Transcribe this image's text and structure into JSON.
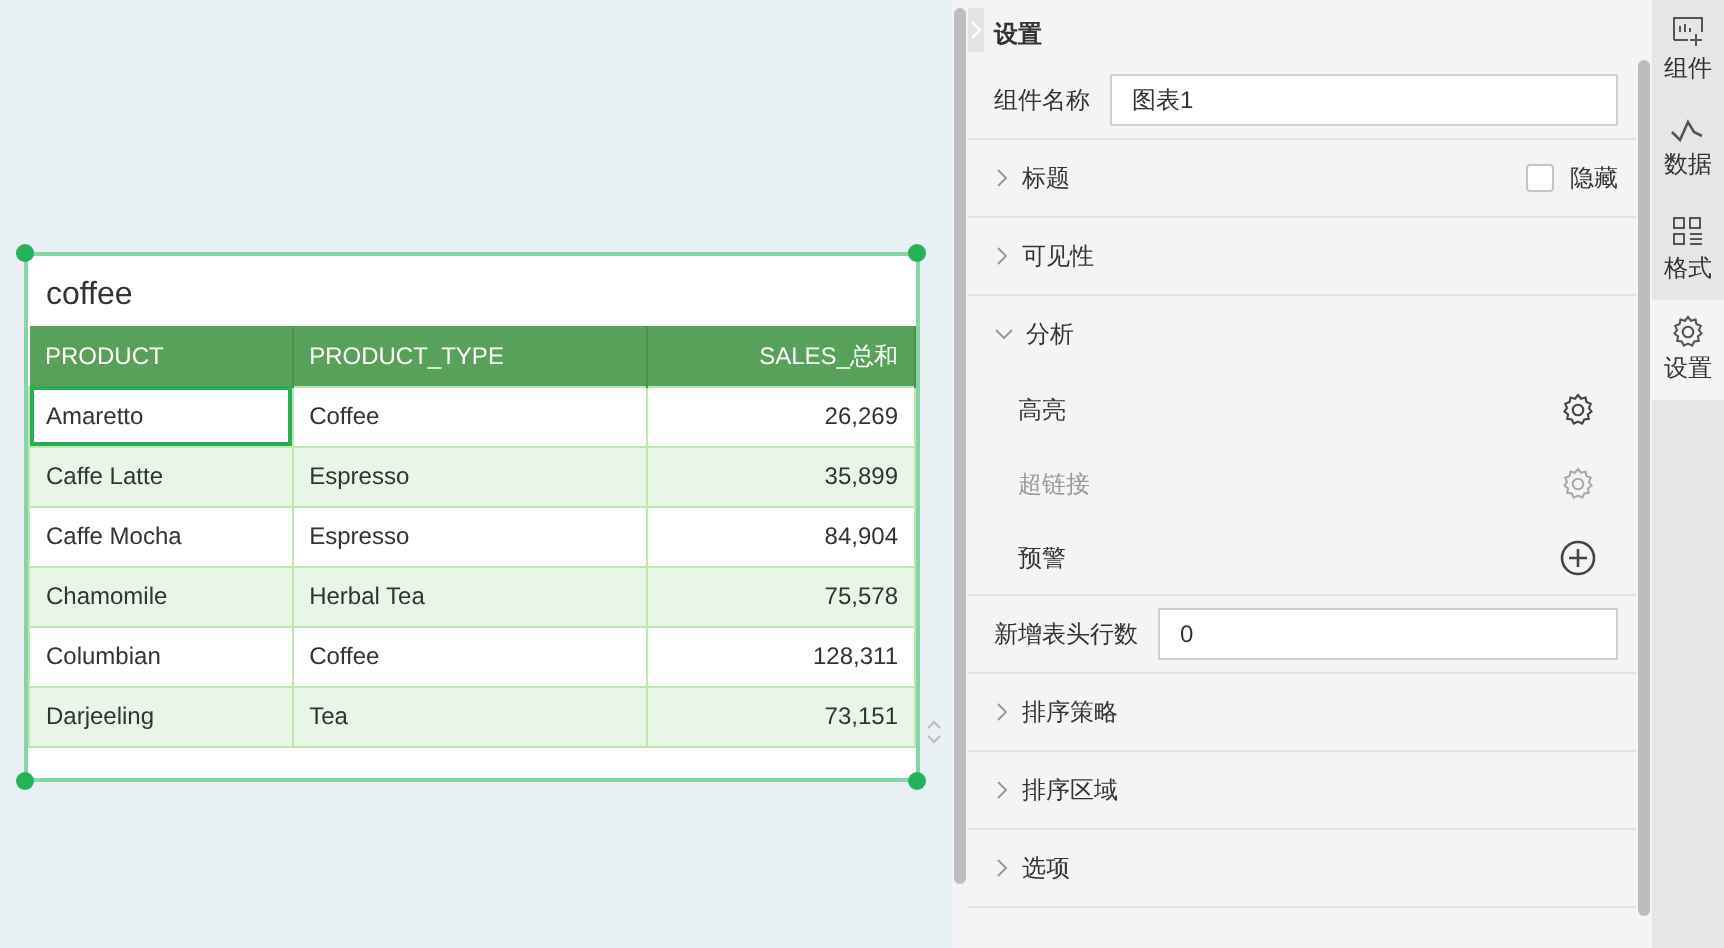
{
  "widget": {
    "title": "coffee",
    "columns": [
      {
        "label": "PRODUCT"
      },
      {
        "label": "PRODUCT_TYPE"
      },
      {
        "label": "SALES_总和"
      }
    ],
    "rows": [
      {
        "cells": [
          {
            "text": "Amaretto",
            "selected": true
          },
          {
            "text": "Coffee",
            "selected": false
          },
          {
            "text": "26,269",
            "selected": false
          }
        ]
      },
      {
        "cells": [
          {
            "text": "Caffe Latte",
            "selected": false
          },
          {
            "text": "Espresso",
            "selected": false
          },
          {
            "text": "35,899",
            "selected": false
          }
        ]
      },
      {
        "cells": [
          {
            "text": "Caffe Mocha",
            "selected": false
          },
          {
            "text": "Espresso",
            "selected": false
          },
          {
            "text": "84,904",
            "selected": false
          }
        ]
      },
      {
        "cells": [
          {
            "text": "Chamomile",
            "selected": false
          },
          {
            "text": "Herbal Tea",
            "selected": false
          },
          {
            "text": "75,578",
            "selected": false
          }
        ]
      },
      {
        "cells": [
          {
            "text": "Columbian",
            "selected": false
          },
          {
            "text": "Coffee",
            "selected": false
          },
          {
            "text": "128,311",
            "selected": false
          }
        ]
      },
      {
        "cells": [
          {
            "text": "Darjeeling",
            "selected": false
          },
          {
            "text": "Tea",
            "selected": false
          },
          {
            "text": "73,151",
            "selected": false
          }
        ]
      }
    ]
  },
  "panel": {
    "title": "设置",
    "items": [
      {
        "kind": "field",
        "label": "组件名称",
        "value": "图表1"
      },
      {
        "kind": "section",
        "label": "标题",
        "expanded": false,
        "checkbox": {
          "label": "隐藏",
          "checked": false
        }
      },
      {
        "kind": "section",
        "label": "可见性",
        "expanded": false
      },
      {
        "kind": "section",
        "label": "分析",
        "expanded": true,
        "children": [
          {
            "label": "高亮",
            "disabled": false,
            "kind": "setting"
          },
          {
            "label": "超链接",
            "disabled": true,
            "kind": "setting"
          },
          {
            "label": "预警",
            "disabled": false,
            "kind": "add"
          }
        ]
      },
      {
        "kind": "field",
        "label": "新增表头行数",
        "value": "0"
      },
      {
        "kind": "section",
        "label": "排序策略",
        "expanded": false
      },
      {
        "kind": "section",
        "label": "排序区域",
        "expanded": false
      },
      {
        "kind": "section",
        "label": "选项",
        "expanded": false
      }
    ]
  },
  "rail": [
    {
      "label": "组件",
      "selected": false
    },
    {
      "label": "数据",
      "selected": false
    },
    {
      "label": "格式",
      "selected": false
    },
    {
      "label": "设置",
      "selected": true
    }
  ]
}
